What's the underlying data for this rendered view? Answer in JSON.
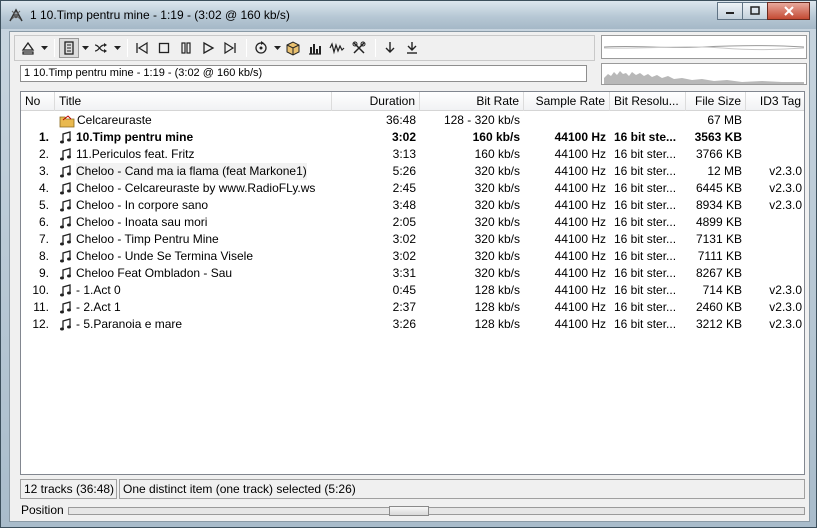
{
  "window": {
    "title": "1 10.Timp pentru mine - 1:19 - (3:02 @ 160 kb/s)",
    "icons": {
      "app": "foobar-icon",
      "min": "minimize-icon",
      "max": "maximize-icon",
      "close": "close-icon"
    }
  },
  "toolbar": {
    "buttons": [
      "eject-icon",
      "playlist-icon",
      "shuffle-icon",
      "prev-icon",
      "stop-icon",
      "pause-icon",
      "play-icon",
      "next-icon",
      "repeat-icon",
      "box-icon",
      "spectrum-icon",
      "wave-icon",
      "tools-icon",
      "down-arrow-icon",
      "download-icon"
    ]
  },
  "nowplaying": "1 10.Timp pentru mine - 1:19 - (3:02 @ 160 kb/s)",
  "columns": [
    "No",
    "Title",
    "Duration",
    "Bit Rate",
    "Sample Rate",
    "Bit Resolu...",
    "File Size",
    "ID3 Tag"
  ],
  "album": {
    "title": "Celcareuraste",
    "duration": "36:48",
    "bitrate": "128 - 320 kb/s",
    "filesize": "67 MB"
  },
  "tracks": [
    {
      "no": "1.",
      "title": "10.Timp pentru mine",
      "duration": "3:02",
      "bitrate": "160 kb/s",
      "samplerate": "44100 Hz",
      "bitres": "16 bit ste...",
      "filesize": "3563 KB",
      "id3": "",
      "bold": true
    },
    {
      "no": "2.",
      "title": "11.Periculos feat. Fritz",
      "duration": "3:13",
      "bitrate": "160 kb/s",
      "samplerate": "44100 Hz",
      "bitres": "16 bit ster...",
      "filesize": "3766 KB",
      "id3": ""
    },
    {
      "no": "3.",
      "title": "Cheloo - Cand ma ia flama (feat Markone1)",
      "duration": "5:26",
      "bitrate": "320 kb/s",
      "samplerate": "44100 Hz",
      "bitres": "16 bit ster...",
      "filesize": "12 MB",
      "id3": "v2.3.0",
      "hl": true
    },
    {
      "no": "4.",
      "title": "Cheloo - Celcareuraste by www.RadioFLy.ws",
      "duration": "2:45",
      "bitrate": "320 kb/s",
      "samplerate": "44100 Hz",
      "bitres": "16 bit ster...",
      "filesize": "6445 KB",
      "id3": "v2.3.0"
    },
    {
      "no": "5.",
      "title": "Cheloo - In corpore sano",
      "duration": "3:48",
      "bitrate": "320 kb/s",
      "samplerate": "44100 Hz",
      "bitres": "16 bit ster...",
      "filesize": "8934 KB",
      "id3": "v2.3.0"
    },
    {
      "no": "6.",
      "title": "Cheloo - Inoata sau mori",
      "duration": "2:05",
      "bitrate": "320 kb/s",
      "samplerate": "44100 Hz",
      "bitres": "16 bit ster...",
      "filesize": "4899 KB",
      "id3": ""
    },
    {
      "no": "7.",
      "title": "Cheloo - Timp Pentru Mine",
      "duration": "3:02",
      "bitrate": "320 kb/s",
      "samplerate": "44100 Hz",
      "bitres": "16 bit ster...",
      "filesize": "7131 KB",
      "id3": ""
    },
    {
      "no": "8.",
      "title": "Cheloo - Unde Se Termina Visele",
      "duration": "3:02",
      "bitrate": "320 kb/s",
      "samplerate": "44100 Hz",
      "bitres": "16 bit ster...",
      "filesize": "7111 KB",
      "id3": ""
    },
    {
      "no": "9.",
      "title": "Cheloo Feat Ombladon - Sau",
      "duration": "3:31",
      "bitrate": "320 kb/s",
      "samplerate": "44100 Hz",
      "bitres": "16 bit ster...",
      "filesize": "8267 KB",
      "id3": ""
    },
    {
      "no": "10.",
      "title": "- 1.Act 0",
      "duration": "0:45",
      "bitrate": "128 kb/s",
      "samplerate": "44100 Hz",
      "bitres": "16 bit ster...",
      "filesize": "714 KB",
      "id3": "v2.3.0"
    },
    {
      "no": "11.",
      "title": "- 2.Act 1",
      "duration": "2:37",
      "bitrate": "128 kb/s",
      "samplerate": "44100 Hz",
      "bitres": "16 bit ster...",
      "filesize": "2460 KB",
      "id3": "v2.3.0"
    },
    {
      "no": "12.",
      "title": "- 5.Paranoia e mare",
      "duration": "3:26",
      "bitrate": "128 kb/s",
      "samplerate": "44100 Hz",
      "bitres": "16 bit ster...",
      "filesize": "3212 KB",
      "id3": "v2.3.0"
    }
  ],
  "status": {
    "summary": "12 tracks (36:48)",
    "selection": "One distinct item (one track) selected (5:26)"
  },
  "position": {
    "label": "Position",
    "progress": 0.46
  }
}
